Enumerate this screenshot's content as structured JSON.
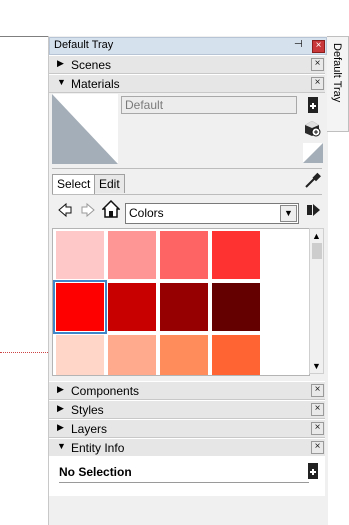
{
  "tray": {
    "title": "Default Tray",
    "side_tab_label": "Default Tray",
    "close_symbol": "×"
  },
  "sections": {
    "scenes": "Scenes",
    "materials": "Materials",
    "components": "Components",
    "styles": "Styles",
    "layers": "Layers",
    "entity_info": "Entity Info"
  },
  "materials": {
    "name_placeholder": "Default",
    "tabs": [
      "Select",
      "Edit"
    ],
    "library": "Colors",
    "swatches": [
      [
        "#ffc8c8",
        "#ff9696",
        "#ff6464",
        "#ff3232"
      ],
      [
        "#ff0000",
        "#c80000",
        "#960000",
        "#640000"
      ],
      [
        "#ffd6c8",
        "#ffaa8c",
        "#ff8c5a",
        "#ff6432"
      ]
    ],
    "selected": "#ff0000"
  },
  "entity_info": {
    "selection": "No Selection"
  },
  "icons": {
    "pin": "pin-icon",
    "back": "back-arrow-icon",
    "forward": "forward-arrow-icon",
    "home": "home-icon",
    "details": "details-arrow-icon",
    "eyedropper": "eyedropper-icon",
    "create_material": "create-material-icon",
    "paint_bucket": "paint-bucket-icon"
  }
}
